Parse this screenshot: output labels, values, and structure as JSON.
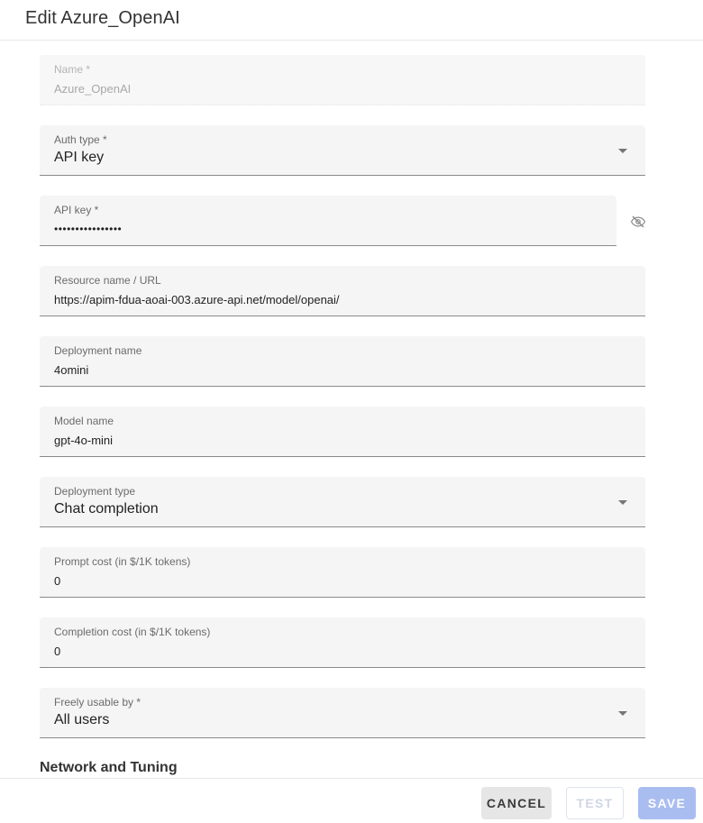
{
  "dialog": {
    "title": "Edit Azure_OpenAI"
  },
  "fields": {
    "name": {
      "label": "Name *",
      "value": "Azure_OpenAI"
    },
    "auth_type": {
      "label": "Auth type *",
      "value": "API key"
    },
    "api_key": {
      "label": "API key *",
      "value": "••••••••••••••••"
    },
    "resource": {
      "label": "Resource name / URL",
      "value": "https://apim-fdua-aoai-003.azure-api.net/model/openai/"
    },
    "deployment_name": {
      "label": "Deployment name",
      "value": "4omini"
    },
    "model_name": {
      "label": "Model name",
      "value": "gpt-4o-mini"
    },
    "deployment_type": {
      "label": "Deployment type",
      "value": "Chat completion"
    },
    "prompt_cost": {
      "label": "Prompt cost (in $/1K tokens)",
      "value": "0"
    },
    "completion_cost": {
      "label": "Completion cost (in $/1K tokens)",
      "value": "0"
    },
    "freely_usable": {
      "label": "Freely usable by *",
      "value": "All users"
    }
  },
  "sections": {
    "network": "Network and Tuning"
  },
  "buttons": {
    "cancel": "CANCEL",
    "test": "TEST",
    "save": "SAVE"
  },
  "icons": {
    "toggle_visibility": "eye-off-icon",
    "dropdown": "chevron-down-icon"
  },
  "colors": {
    "primary_disabled": "#aabdf0",
    "field_bg": "#f5f5f5"
  }
}
